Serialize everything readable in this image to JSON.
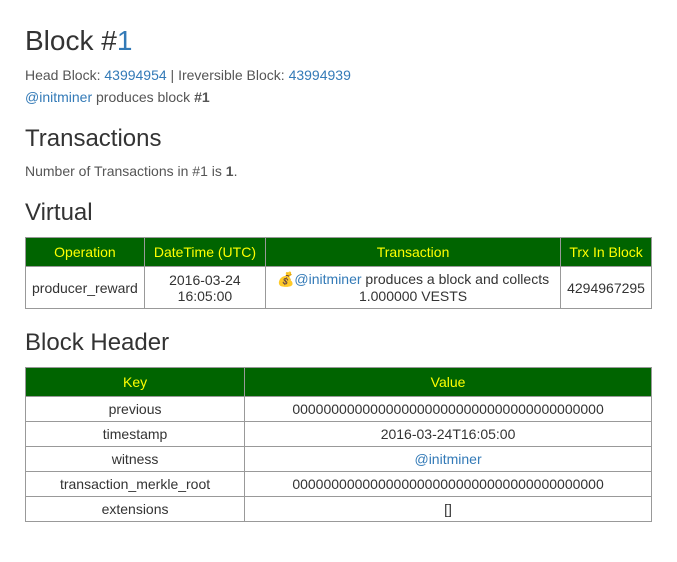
{
  "title": {
    "prefix": "Block #",
    "number": "1"
  },
  "headLine": {
    "headLabel": "Head Block: ",
    "headLink": "43994954",
    "sep": " | Ireversible Block: ",
    "irrLink": "43994939"
  },
  "producerLine": {
    "user": "@initminer",
    "text1": " produces block ",
    "blockRef": "#1"
  },
  "txSection": {
    "heading": "Transactions",
    "lineA": "Number of Transactions in #1 is ",
    "count": "1",
    "lineB": "."
  },
  "virtual": {
    "heading": "Virtual",
    "headers": {
      "op": "Operation",
      "dt": "DateTime (UTC)",
      "tx": "Transaction",
      "trxInBlock": "Trx In Block"
    },
    "row": {
      "op": "producer_reward",
      "dt": "2016-03-24 16:05:00",
      "icon": "💰",
      "user": "@initminer",
      "desc": " produces a block and collects 1.000000 VESTS",
      "trxInBlock": "4294967295"
    }
  },
  "blockHeader": {
    "heading": "Block Header",
    "headers": {
      "key": "Key",
      "value": "Value"
    },
    "rows": [
      {
        "k": "previous",
        "v": "0000000000000000000000000000000000000000",
        "link": false
      },
      {
        "k": "timestamp",
        "v": "2016-03-24T16:05:00",
        "link": false
      },
      {
        "k": "witness",
        "v": "@initminer",
        "link": true
      },
      {
        "k": "transaction_merkle_root",
        "v": "0000000000000000000000000000000000000000",
        "link": false
      },
      {
        "k": "extensions",
        "v": "[]",
        "link": false
      }
    ]
  }
}
